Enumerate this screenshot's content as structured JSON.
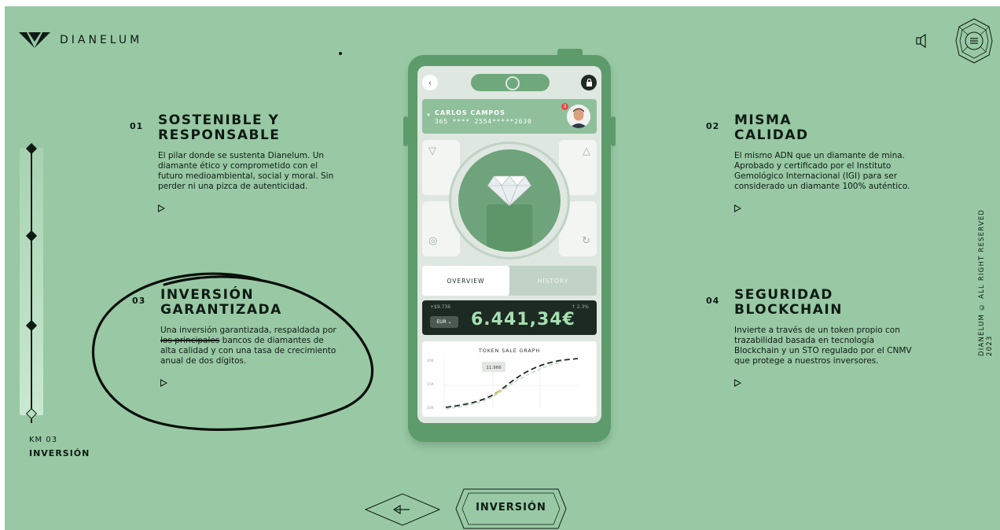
{
  "brand": {
    "name": "DIANELUM",
    "logo_icon": "diamond-logo-icon"
  },
  "header": {
    "sound_icon": "speaker-icon",
    "menu_icon": "hamburger-menu-icon"
  },
  "progress": {
    "km_label": "KM 03",
    "section_title": "INVERSIÓN",
    "steps": 4,
    "current_step": 4
  },
  "features": [
    {
      "num": "01",
      "title_line1": "SOSTENIBLE Y",
      "title_line2": "RESPONSABLE",
      "text": "El pilar donde se sustenta Dianelum. Un diamante ético y comprometido con el futuro medioambiental, social y moral. Sin perder ni una pizca de autenticidad."
    },
    {
      "num": "02",
      "title_line1": "MISMA",
      "title_line2": "CALIDAD",
      "text": "El mismo ADN que un diamante de mina. Aprobado y certificado por el Instituto Gemológico Internacional (IGI) para ser considerado un diamante 100% auténtico."
    },
    {
      "num": "03",
      "title_line1": "INVERSIÓN",
      "title_line2": "GARANTIZADA",
      "text_before": "Una inversión garantizada, respaldada por ",
      "text_struck": "los principales",
      "text_after": " bancos de diamantes de alta calidad y con una tasa de crecimiento anual de dos dígitos."
    },
    {
      "num": "04",
      "title_line1": "SEGURIDAD",
      "title_line2": "BLOCKCHAIN",
      "text": "Invierte a través de un token propio con trazabilidad basada en tecnología Blockchain y un STO regulado por el CNMV que protege a nuestros inversores."
    }
  ],
  "copyright": "DIANELUM © ALL RIGHT RESERVED 2023",
  "phone": {
    "user_name": "CARLOS CAMPOS",
    "card_number": "365 **** 2554*****2630",
    "notification_count": "3",
    "tabs": [
      "OVERVIEW",
      "HISTORY"
    ],
    "active_tab": "OVERVIEW",
    "balance_change_abs": "+$9.736",
    "balance_change_pct": "↑ 2.3%",
    "currency": "EUR",
    "balance": "6.441,34€",
    "graph_title": "TOKEN SALE GRAPH",
    "graph_tooltip": "11.966",
    "graph_y_ticks": [
      "20K",
      "15K",
      "20K"
    ]
  },
  "bottom_nav": {
    "prev_icon": "arrow-left-icon",
    "current_label": "INVERSIÓN"
  },
  "colors": {
    "background": "#98c9a4",
    "phone_body": "#5d9b6b",
    "balance_text": "#a6dfb2",
    "ink": "#0f1a14"
  }
}
